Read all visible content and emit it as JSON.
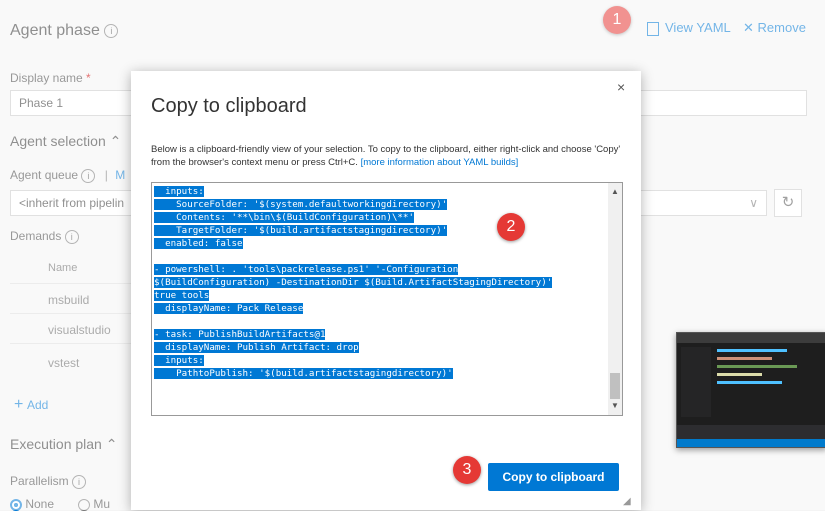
{
  "background": {
    "title": "Agent phase",
    "view_yaml": "View YAML",
    "remove": "Remove",
    "display_name_label": "Display name",
    "required_mark": "*",
    "display_name_value": "Phase 1",
    "agent_selection": "Agent selection",
    "agent_queue": "Agent queue",
    "queue_sep": "|",
    "queue_link_partial": "M",
    "queue_value": "<inherit from pipelin",
    "demands": "Demands",
    "name_header": "Name",
    "demand_rows": [
      "msbuild",
      "visualstudio",
      "vstest"
    ],
    "add": "Add",
    "execution_plan": "Execution plan",
    "parallelism": "Parallelism",
    "radio_none": "None",
    "radio_multi_partial": "Mu"
  },
  "callouts": [
    "1",
    "2",
    "3"
  ],
  "dialog": {
    "title": "Copy to clipboard",
    "close_glyph": "×",
    "description": "Below is a clipboard-friendly view of your selection. To copy to the clipboard, either right-click and choose 'Copy' from the browser's context menu or press Ctrl+C.",
    "more_info": "[more information about YAML builds]",
    "code_lines": [
      "  inputs:",
      "    SourceFolder: '$(system.defaultworkingdirectory)'",
      "    Contents: '**\\bin\\$(BuildConfiguration)\\**'",
      "    TargetFolder: '$(build.artifactstagingdirectory)'",
      "  enabled: false",
      "",
      "- powershell: . 'tools\\packrelease.ps1' '-Configuration",
      "$(BuildConfiguration) -DestinationDir $(Build.ArtifactStagingDirectory)'",
      "true tools",
      "  displayName: Pack Release",
      "",
      "- task: PublishBuildArtifacts@1",
      "  displayName: Publish Artifact: drop",
      "  inputs:",
      "    PathtoPublish: '$(build.artifactstagingdirectory)'"
    ],
    "copy_button": "Copy to clipboard"
  },
  "colors": {
    "accent": "#0078d4",
    "callout": "#e53935"
  },
  "icons": [
    "info-icon",
    "yaml-icon",
    "close-icon",
    "chevron-up-icon",
    "chevron-down-icon",
    "refresh-icon",
    "plus-icon",
    "resize-grip-icon"
  ]
}
